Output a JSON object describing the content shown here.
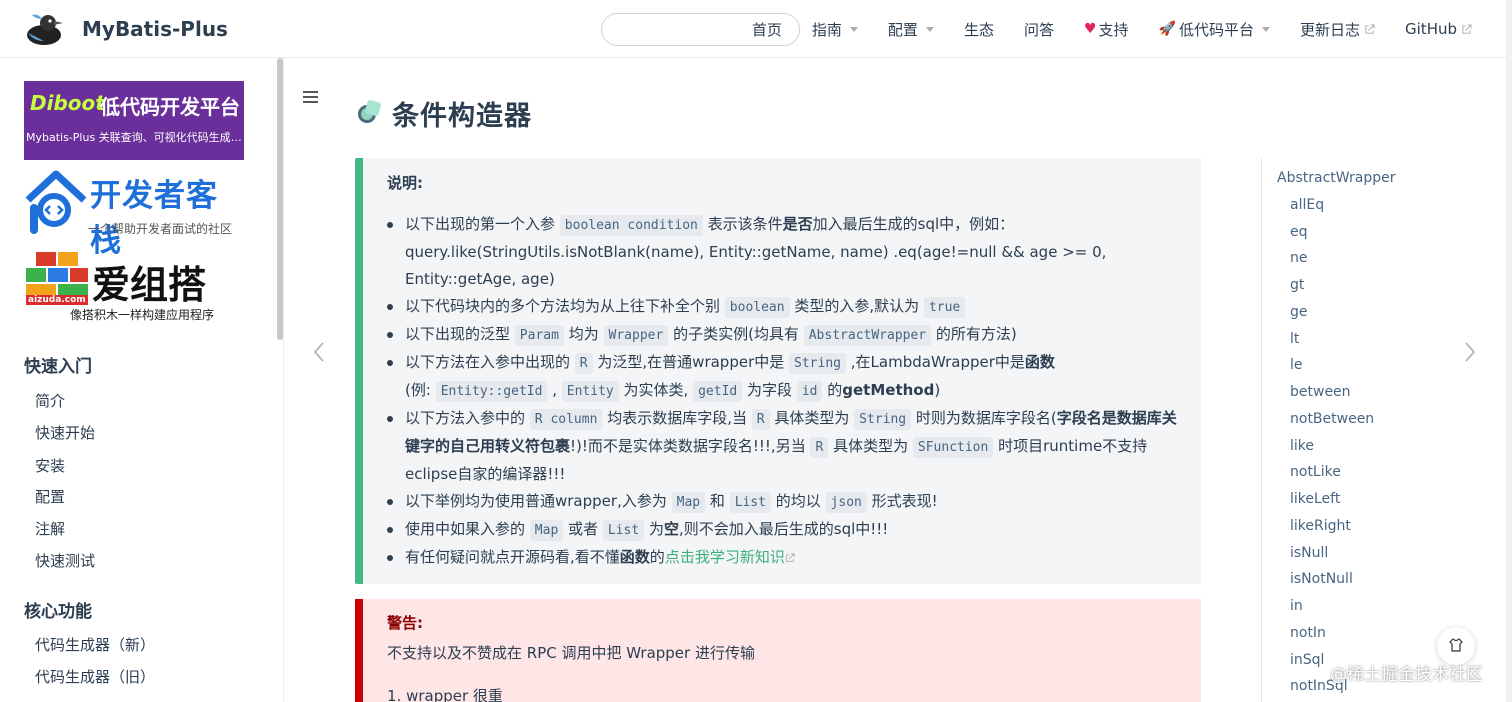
{
  "navbar": {
    "site_name": "MyBatis-Plus",
    "search_placeholder": "",
    "links": [
      {
        "label": "首页"
      },
      {
        "label": "指南"
      },
      {
        "label": "配置"
      },
      {
        "label": "生态"
      },
      {
        "label": "问答"
      },
      {
        "label": "支持"
      },
      {
        "label": "低代码平台"
      },
      {
        "label": "更新日志"
      },
      {
        "label": "GitHub"
      }
    ]
  },
  "sidebar": {
    "ads": {
      "diboot_logo": "Diboot",
      "diboot_title": "低代码开发平台",
      "diboot_sub": "Mybatis-Plus 关联查询、可视化代码生成 ...",
      "devstack_title": "开发者客栈",
      "devstack_sub": "一个帮助开发者面试的社区",
      "aizuda_title": "爱组搭",
      "aizuda_url": "aizuda.com",
      "aizuda_sub": "像搭积木一样构建应用程序"
    },
    "section1": "快速入门",
    "items1": [
      "简介",
      "快速开始",
      "安装",
      "配置",
      "注解",
      "快速测试"
    ],
    "section2": "核心功能",
    "items2": [
      "代码生成器（新）",
      "代码生成器（旧）"
    ]
  },
  "main": {
    "title": "条件构造器",
    "tip": {
      "title": "说明:",
      "bullets": [
        {
          "parts": [
            "以下出现的第一个入参",
            "boolean condition",
            "表示该条件",
            "是否",
            "加入最后生成的sql中，例如：query.like(StringUtils.isNotBlank(name), Entity::getName, name) .eq(age!=null && age >= 0, Entity::getAge, age)"
          ]
        },
        {
          "parts": [
            "以下代码块内的多个方法均为从上往下补全个别",
            "boolean",
            "类型的入参,默认为",
            "true"
          ]
        },
        {
          "parts": [
            "以下出现的泛型",
            "Param",
            "均为",
            "Wrapper",
            "的子类实例(均具有",
            "AbstractWrapper",
            "的所有方法)"
          ]
        },
        {
          "parts": [
            "以下方法在入参中出现的",
            "R",
            "为泛型,在普通wrapper中是",
            "String",
            ",在LambdaWrapper中是",
            "函数",
            "(例:",
            "Entity::getId",
            ",",
            "Entity",
            "为实体类,",
            "getId",
            "为字段",
            "id",
            "的",
            "getMethod",
            ")"
          ]
        },
        {
          "parts": [
            "以下方法入参中的",
            "R column",
            "均表示数据库字段,当",
            "R",
            "具体类型为",
            "String",
            "时则为数据库字段名(",
            "字段名是数据库关键字的自己用转义符包裹",
            "!)!而不是实体类数据字段名!!!,另当",
            "R",
            "具体类型为",
            "SFunction",
            "时项目runtime不支持eclipse自家的编译器!!!"
          ]
        },
        {
          "parts": [
            "以下举例均为使用普通wrapper,入参为",
            "Map",
            "和",
            "List",
            "的均以",
            "json",
            "形式表现!"
          ]
        },
        {
          "parts": [
            "使用中如果入参的",
            "Map",
            "或者",
            "List",
            "为",
            "空",
            ",则不会加入最后生成的sql中!!!"
          ]
        },
        {
          "parts": [
            "有任何疑问就点开源码看,看不懂",
            "函数",
            "的",
            "点击我学习新知识"
          ]
        }
      ]
    },
    "warning": {
      "title": "警告:",
      "text": "不支持以及不赞成在 RPC 调用中把 Wrapper 进行传输",
      "item1": "1. wrapper 很重"
    }
  },
  "toc": {
    "top": "AbstractWrapper",
    "items": [
      "allEq",
      "eq",
      "ne",
      "gt",
      "ge",
      "lt",
      "le",
      "between",
      "notBetween",
      "like",
      "notLike",
      "likeLeft",
      "likeRight",
      "isNull",
      "isNotNull",
      "in",
      "notIn",
      "inSql",
      "notInSql"
    ]
  },
  "watermark": "@稀土掘金技术社区",
  "colors": {
    "accent": "#3eaf7c",
    "tip_border": "#42b983",
    "warn_border": "#cc0000",
    "warn_bg": "#fee6e6"
  }
}
